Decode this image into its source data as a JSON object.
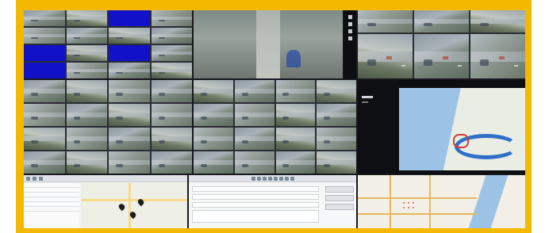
{
  "wall": {
    "frame_color": "#f5b800",
    "screen_bg": "#16181c"
  },
  "top_left_grid": {
    "tiles": [
      "cam",
      "cam",
      "blue",
      "cam",
      "cam",
      "cam",
      "cam",
      "cam",
      "cam",
      "cam",
      "blue",
      "cam",
      "blue",
      "cam",
      "cam",
      "cam"
    ],
    "blue_color": "#1111c8"
  },
  "top_right_grid": {
    "tiles": [
      "cam",
      "cam",
      "cam",
      "cam",
      "cam",
      "cam"
    ]
  },
  "camera_grids": {
    "left_count": 16,
    "right_count": 16
  },
  "map_panel": {
    "header_label": "",
    "water_color": "#9cc3e6",
    "river_color": "#2e6fc8"
  },
  "bottom_left_app": {
    "type": "map-with-list",
    "rows": 6
  },
  "bottom_center_app": {
    "type": "form"
  },
  "bottom_right_map": {
    "type": "city-map"
  }
}
